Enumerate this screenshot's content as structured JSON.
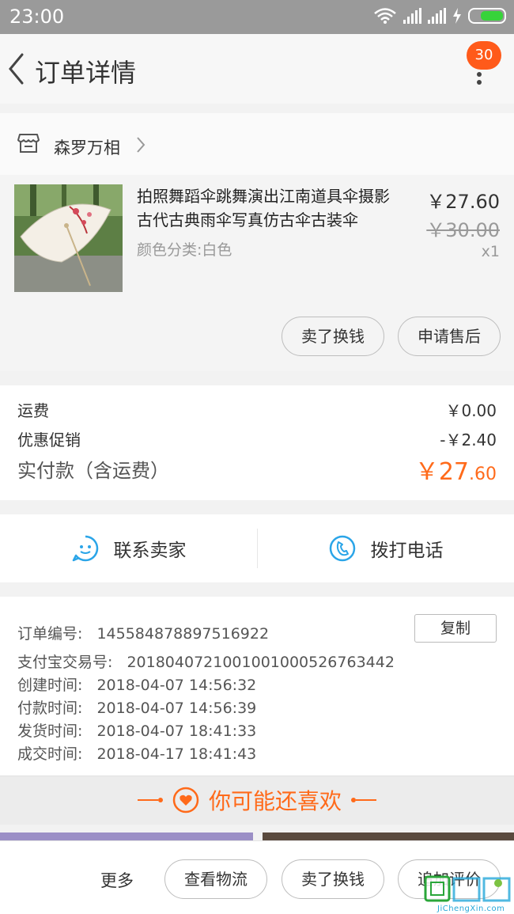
{
  "status_bar": {
    "time": "23:00"
  },
  "nav": {
    "title": "订单详情",
    "badge_count": "30"
  },
  "shop": {
    "name": "森罗万相"
  },
  "product": {
    "title_line1": "拍照舞蹈伞跳舞演出江南道具伞摄影",
    "title_line2": "古代古典雨伞写真仿古伞古装伞",
    "spec": "颜色分类:白色",
    "price_now": "￥27.60",
    "price_old": "￥30.00",
    "quantity": "x1",
    "actions": {
      "sell": "卖了换钱",
      "after_sale": "申请售后"
    }
  },
  "fees": {
    "shipping_label": "运费",
    "shipping_value": "￥0.00",
    "discount_label": "优惠促销",
    "discount_value": "-￥2.40",
    "total_label": "实付款（含运费）",
    "total_currency": "￥",
    "total_int": "27",
    "total_dec": ".60"
  },
  "contact": {
    "seller": "联系卖家",
    "phone": "拨打电话"
  },
  "order_info": {
    "order_no_label": "订单编号:",
    "order_no": "145584878897516922",
    "copy": "复制",
    "alipay_label": "支付宝交易号:",
    "alipay_no": "2018040721001001000526763442",
    "created_label": "创建时间:",
    "created": "2018-04-07 14:56:32",
    "paid_label": "付款时间:",
    "paid": "2018-04-07 14:56:39",
    "shipped_label": "发货时间:",
    "shipped": "2018-04-07 18:41:33",
    "closed_label": "成交时间:",
    "closed": "2018-04-17 18:41:43"
  },
  "recommend": {
    "title": "你可能还喜欢"
  },
  "bottom_bar": {
    "more": "更多",
    "logistics": "查看物流",
    "sell": "卖了换钱",
    "review": "追加评价"
  },
  "watermark": {
    "text": "JiChengXin.com"
  },
  "colors": {
    "accent": "#ff6a1a",
    "icon_blue": "#2ba5e8"
  }
}
